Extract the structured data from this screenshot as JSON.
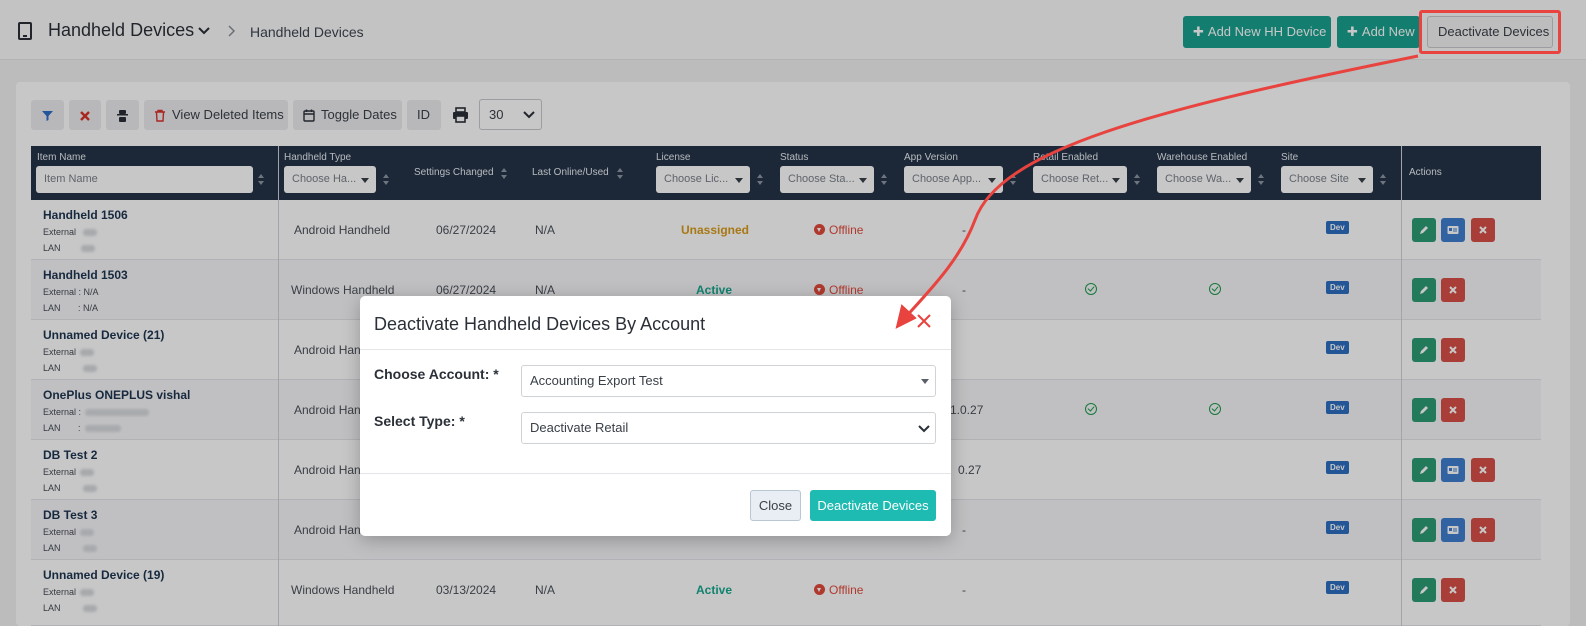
{
  "header": {
    "title": "Handheld Devices",
    "breadcrumb": "Handheld Devices",
    "add_hh_label": "Add New HH Device",
    "add_new_label": "Add New",
    "deactivate_label": "Deactivate Devices"
  },
  "toolbar": {
    "view_deleted_label": "View Deleted Items",
    "toggle_dates_label": "Toggle Dates",
    "id_label": "ID",
    "page_size": "30"
  },
  "table": {
    "columns": {
      "item_name": "Item Name",
      "item_name_placeholder": "Item Name",
      "handheld_type": "Handheld Type",
      "handheld_type_placeholder": "Choose Ha...",
      "settings_changed": "Settings Changed",
      "last_online": "Last Online/Used",
      "license": "License",
      "license_placeholder": "Choose Lic...",
      "status": "Status",
      "status_placeholder": "Choose Sta...",
      "app_version": "App Version",
      "app_version_placeholder": "Choose App...",
      "retail_enabled": "Retail Enabled",
      "retail_placeholder": "Choose Ret...",
      "warehouse_enabled": "Warehouse Enabled",
      "warehouse_placeholder": "Choose Wa...",
      "site": "Site",
      "site_placeholder": "Choose Site",
      "actions": "Actions"
    },
    "ext_label": "External",
    "lan_label": "LAN",
    "rows": [
      {
        "name": "Handheld 1506",
        "ext": "",
        "lan": "",
        "type": "Android Handheld",
        "settings": "06/27/2024",
        "last": "N/A",
        "license": "Unassigned",
        "status": "Offline",
        "version": "-",
        "site": "Dev"
      },
      {
        "name": "Handheld 1503",
        "ext": ": N/A",
        "lan": ": N/A",
        "type": "Windows Handheld",
        "settings": "06/27/2024",
        "last": "N/A",
        "license": "Active",
        "status": "Offline",
        "version": "-",
        "site": "Dev"
      },
      {
        "name": "Unnamed Device (21)",
        "ext": "",
        "lan": "",
        "type": "Android Hand",
        "settings": "",
        "last": "",
        "license": "",
        "status": "",
        "version": "-",
        "site": "Dev"
      },
      {
        "name": "OnePlus ONEPLUS vishal",
        "ext": ":",
        "lan": ":",
        "type": "Android Hand",
        "settings": "",
        "last": "",
        "license": "",
        "status": "",
        "version": "1.0.27",
        "site": "Dev"
      },
      {
        "name": "DB Test 2",
        "ext": "",
        "lan": "",
        "type": "Android Hand",
        "settings": "",
        "last": "",
        "license": "",
        "status": "",
        "version": "0.27",
        "site": "Dev"
      },
      {
        "name": "DB Test 3",
        "ext": "",
        "lan": "",
        "type": "Android Hand",
        "settings": "",
        "last": "",
        "license": "",
        "status": "",
        "version": "-",
        "site": "Dev"
      },
      {
        "name": "Unnamed Device (19)",
        "ext": "",
        "lan": "",
        "type": "Windows Handheld",
        "settings": "03/13/2024",
        "last": "N/A",
        "license": "Active",
        "status": "Offline",
        "version": "-",
        "site": "Dev"
      }
    ]
  },
  "modal": {
    "title": "Deactivate Handheld Devices By Account",
    "account_label": "Choose Account: *",
    "account_value": "Accounting Export Test",
    "type_label": "Select Type: *",
    "type_value": "Deactivate Retail",
    "close_label": "Close",
    "deactivate_label": "Deactivate Devices"
  },
  "colors": {
    "teal": "#19a08f",
    "header_dark": "#243448",
    "annotation_red": "#e8433e",
    "modal_primary": "#1dbbb2"
  }
}
